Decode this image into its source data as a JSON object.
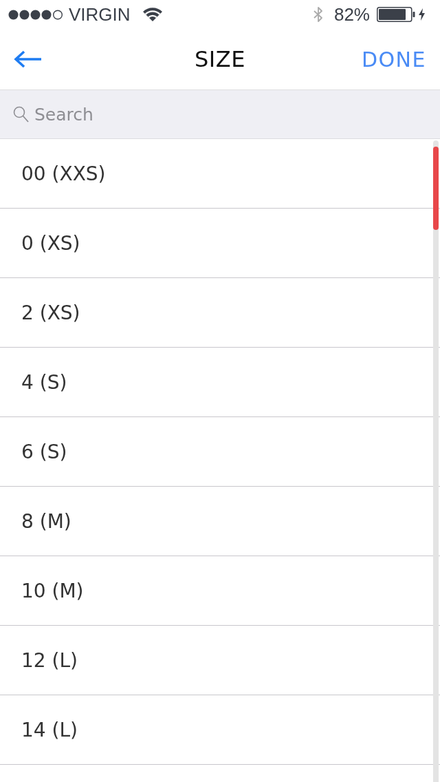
{
  "status_bar": {
    "carrier": "VIRGIN",
    "battery_percent": "82%"
  },
  "nav_bar": {
    "title": "SIZE",
    "done": "DONE"
  },
  "search": {
    "placeholder": "Search"
  },
  "sizes": [
    "00 (XXS)",
    "0 (XS)",
    "2 (XS)",
    "4 (S)",
    "6 (S)",
    "8 (M)",
    "10 (M)",
    "12 (L)",
    "14 (L)"
  ]
}
